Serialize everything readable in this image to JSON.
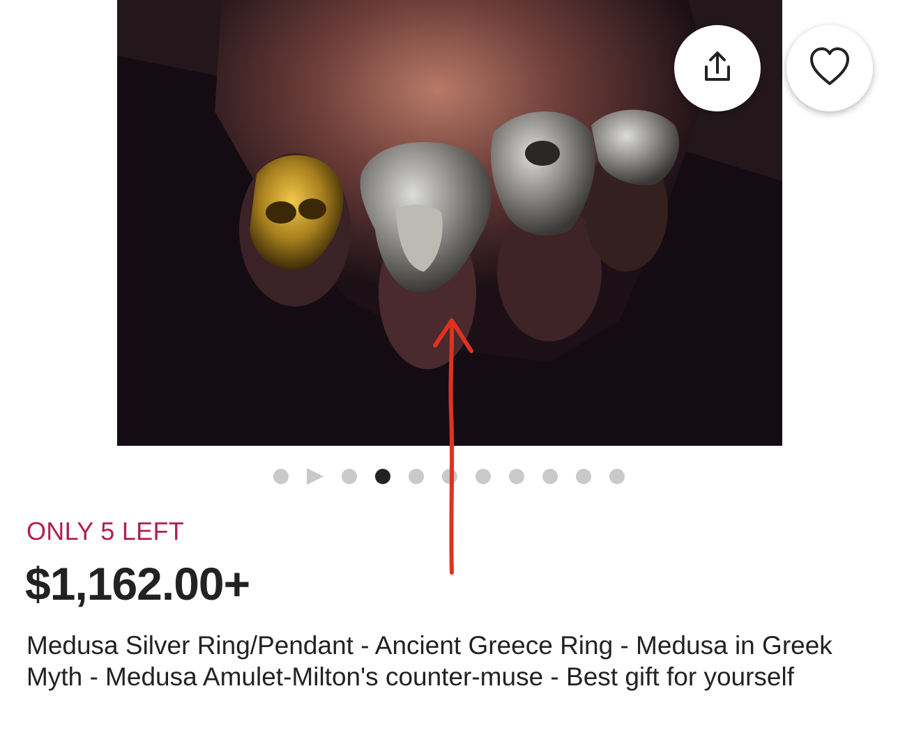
{
  "listing": {
    "image": {
      "description_icon": "product-photo",
      "carousel": {
        "total": 11,
        "active_index": 3,
        "video_index": 1
      }
    },
    "actions": {
      "share_icon": "share-icon",
      "favorite_icon": "heart-icon"
    },
    "stock_label": "ONLY 5 LEFT",
    "price": "$1,162.00+",
    "title": "Medusa Silver Ring/Pendant - Ancient Greece Ring - Medusa in Greek Myth - Medusa Amulet-Milton's counter-muse - Best gift for yourself"
  },
  "colors": {
    "stock": "#b0204a",
    "text": "#222222",
    "dot_inactive": "#c9c9c9",
    "dot_active": "#222222",
    "annotation_arrow": "#e0321e"
  }
}
